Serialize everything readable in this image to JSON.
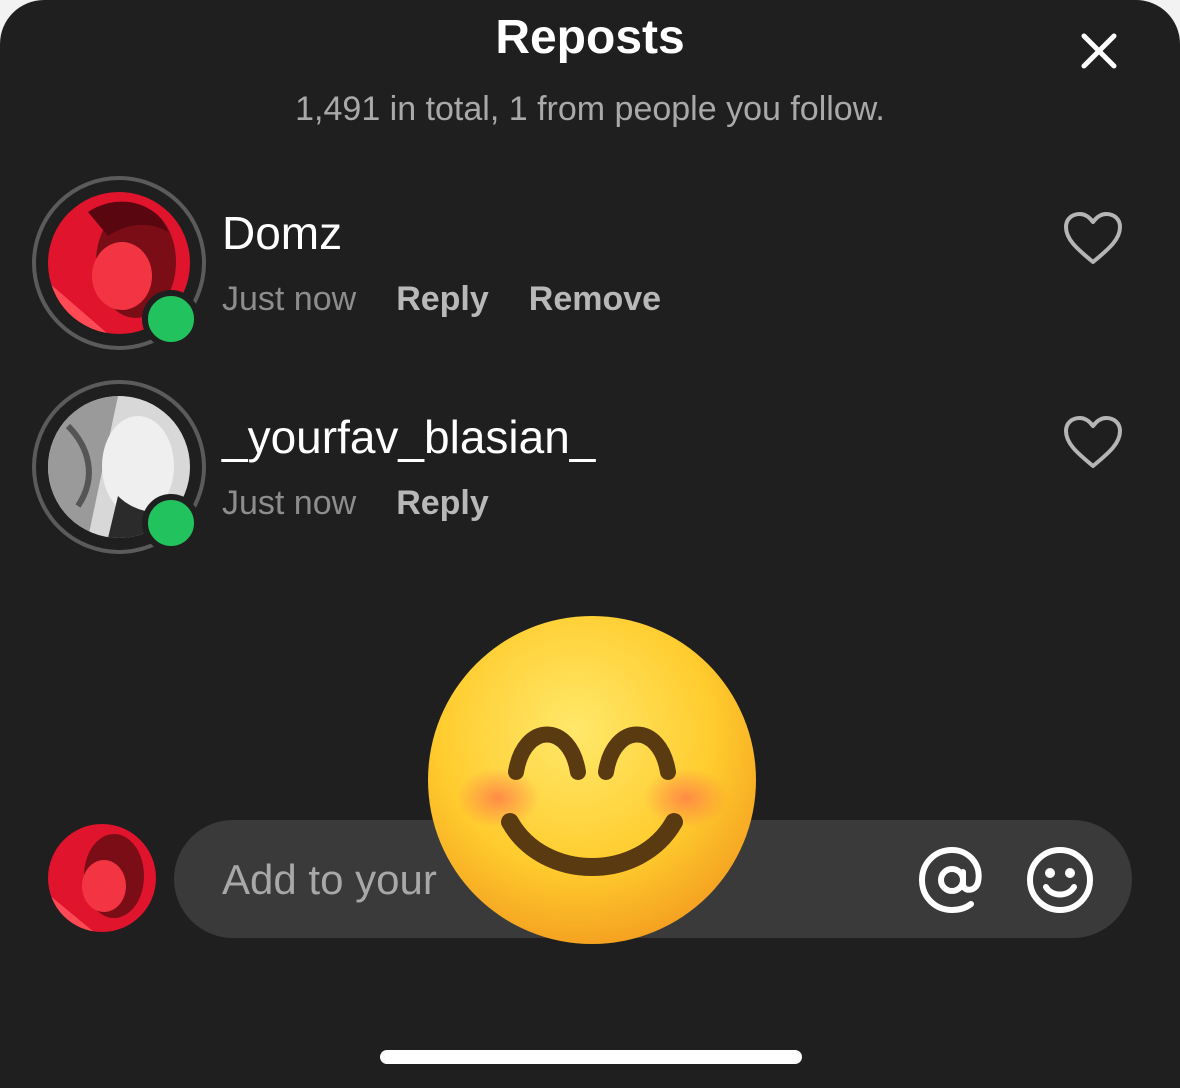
{
  "header": {
    "title": "Reposts",
    "subtitle": "1,491 in total, 1 from people you follow.",
    "close_icon": "close-icon"
  },
  "reposts": [
    {
      "username": "Domz",
      "time": "Just now",
      "actions": [
        "Reply",
        "Remove"
      ],
      "online": true,
      "avatar_color": "#e01a2f"
    },
    {
      "username": "_yourfav_blasian_",
      "time": "Just now",
      "actions": [
        "Reply"
      ],
      "online": true,
      "avatar_color": "#bdbdbd"
    }
  ],
  "composer": {
    "placeholder": "Add to your",
    "icons": [
      "at-icon",
      "emoji-icon"
    ]
  },
  "overlay": {
    "emoji": "smiling-face-with-smiling-eyes"
  },
  "colors": {
    "sheet_bg": "#1f1f1f",
    "online": "#22c35e",
    "input_bg": "#3a3a3a"
  }
}
